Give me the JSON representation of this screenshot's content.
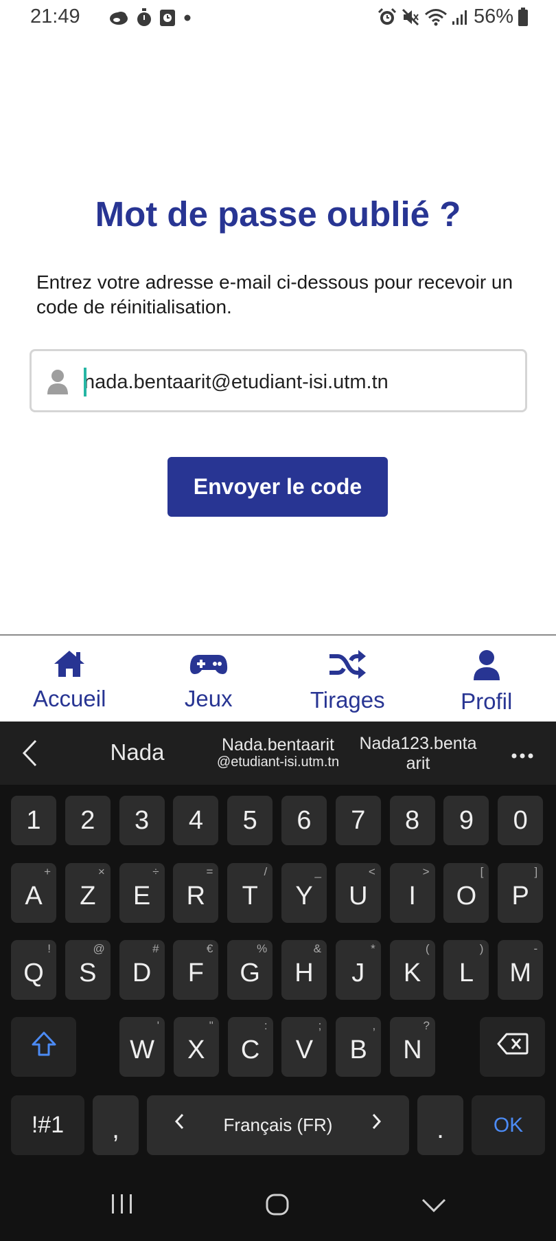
{
  "status_bar": {
    "time": "21:49",
    "left_icons": [
      "cloud-icon",
      "timer-icon",
      "clock-app-icon",
      "notification-dot-icon"
    ],
    "right_icons": [
      "alarm-icon",
      "mute-icon",
      "wifi-icon",
      "signal-icon"
    ],
    "battery": "56%"
  },
  "page": {
    "title": "Mot de passe oublié ?",
    "instructions": "Entrez votre adresse e-mail ci-dessous pour recevoir un code de réinitialisation.",
    "email_value": "nada.bentaarit@etudiant-isi.utm.tn",
    "send_button": "Envoyer le code"
  },
  "bottom_nav": {
    "items": [
      {
        "label": "Accueil",
        "icon": "home-icon"
      },
      {
        "label": "Jeux",
        "icon": "gamepad-icon"
      },
      {
        "label": "Tirages",
        "icon": "shuffle-icon"
      },
      {
        "label": "Profil",
        "icon": "person-icon"
      }
    ]
  },
  "keyboard": {
    "suggestions": {
      "s1": "Nada",
      "s2_line1": "Nada.bentaarit",
      "s2_line2": "@etudiant-isi.utm.tn",
      "s3_line1": "Nada123.benta",
      "s3_line2": "arit"
    },
    "number_row": [
      "1",
      "2",
      "3",
      "4",
      "5",
      "6",
      "7",
      "8",
      "9",
      "0"
    ],
    "row1": [
      {
        "key": "A",
        "hint": "+"
      },
      {
        "key": "Z",
        "hint": "×"
      },
      {
        "key": "E",
        "hint": "÷"
      },
      {
        "key": "R",
        "hint": "="
      },
      {
        "key": "T",
        "hint": "/"
      },
      {
        "key": "Y",
        "hint": "_"
      },
      {
        "key": "U",
        "hint": "<"
      },
      {
        "key": "I",
        "hint": ">"
      },
      {
        "key": "O",
        "hint": "["
      },
      {
        "key": "P",
        "hint": "]"
      }
    ],
    "row2": [
      {
        "key": "Q",
        "hint": "!"
      },
      {
        "key": "S",
        "hint": "@"
      },
      {
        "key": "D",
        "hint": "#"
      },
      {
        "key": "F",
        "hint": "€"
      },
      {
        "key": "G",
        "hint": "%"
      },
      {
        "key": "H",
        "hint": "&"
      },
      {
        "key": "J",
        "hint": "*"
      },
      {
        "key": "K",
        "hint": "("
      },
      {
        "key": "L",
        "hint": ")"
      },
      {
        "key": "M",
        "hint": "-"
      }
    ],
    "row3": [
      {
        "key": "W",
        "hint": "'"
      },
      {
        "key": "X",
        "hint": "\""
      },
      {
        "key": "C",
        "hint": ":"
      },
      {
        "key": "V",
        "hint": ";"
      },
      {
        "key": "B",
        "hint": ","
      },
      {
        "key": "N",
        "hint": "?"
      }
    ],
    "symbols_key": "!#1",
    "comma_key": ",",
    "space_label": "Français (FR)",
    "period_key": ".",
    "ok_key": "OK"
  },
  "colors": {
    "primary": "#283593",
    "ok_key": "#4c8bf5",
    "shift_icon": "#4c8bf5"
  }
}
